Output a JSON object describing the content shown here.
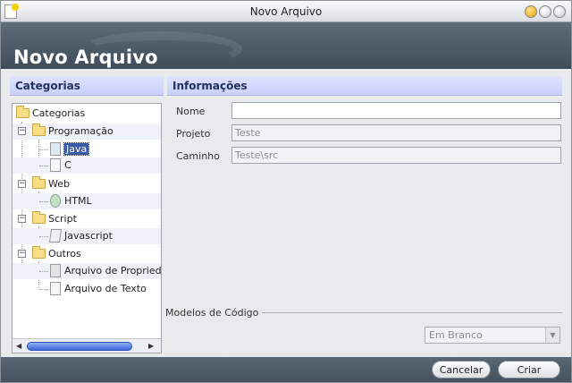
{
  "window": {
    "title": "Novo Arquivo"
  },
  "banner": {
    "heading": "Novo Arquivo"
  },
  "categories": {
    "header": "Categorias",
    "tree": {
      "root": "Categorias",
      "programacao": "Programação",
      "java": "Java",
      "c": "C",
      "web": "Web",
      "html": "HTML",
      "script": "Script",
      "javascript": "Javascript",
      "outros": "Outros",
      "props": "Arquivo de Propriedad",
      "texto": "Arquivo de Texto"
    },
    "selected": "Java"
  },
  "info": {
    "header": "Informações",
    "nome_label": "Nome",
    "nome_value": "",
    "projeto_label": "Projeto",
    "projeto_value": "Teste",
    "caminho_label": "Caminho",
    "caminho_value": "Teste\\src"
  },
  "modelos": {
    "label": "Modelos de Código",
    "selected": "Em Branco"
  },
  "footer": {
    "cancel_label": "Cancelar",
    "create_label": "Criar"
  },
  "icons": {
    "folder": "folder-icon",
    "java": "java-file-icon",
    "c": "c-file-icon",
    "html": "html-file-icon",
    "javascript": "javascript-file-icon",
    "properties": "properties-file-icon",
    "text": "text-file-icon"
  }
}
